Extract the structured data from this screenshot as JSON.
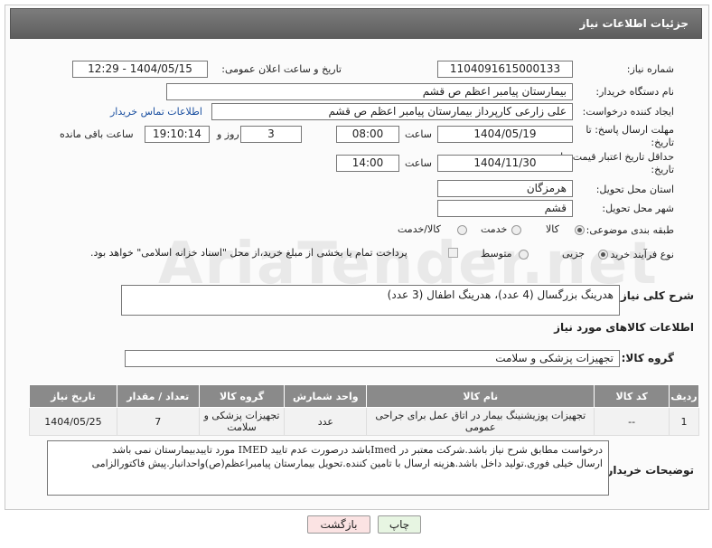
{
  "header": {
    "title": "جزئیات اطلاعات نیاز"
  },
  "fields": {
    "need_number_label": "شماره نیاز:",
    "need_number": "1104091615000133",
    "announce_label": "تاریخ و ساعت اعلان عمومی:",
    "announce_value": "1404/05/15 - 12:29",
    "buyer_org_label": "نام دستگاه خریدار:",
    "buyer_org": "بیمارستان پیامبر اعظم  ص  قشم",
    "requester_label": "ایجاد کننده درخواست:",
    "requester": "علی زارعی کارپرداز بیمارستان پیامبر اعظم  ص  قشم",
    "buyer_contact_link": "اطلاعات تماس خریدار",
    "reply_deadline_label": "مهلت ارسال پاسخ: تا تاریخ:",
    "reply_date": "1404/05/19",
    "time_label": "ساعت",
    "reply_time": "08:00",
    "days_value": "3",
    "days_label": "روز و",
    "remaining_time": "19:10:14",
    "remaining_label": "ساعت باقی مانده",
    "price_validity_label": "حداقل تاریخ اعتبار قیمت: تا تاریخ:",
    "price_date": "1404/11/30",
    "price_time": "14:00",
    "province_label": "استان محل تحویل:",
    "province": "هرمزگان",
    "city_label": "شهر محل تحویل:",
    "city": "قشم",
    "category_label": "طبقه بندی موضوعی:",
    "category_options": [
      "کالا",
      "خدمت",
      "کالا/خدمت"
    ],
    "purchase_type_label": "نوع فرآیند خرید :",
    "purchase_options": [
      "جزیی",
      "متوسط"
    ],
    "payment_note": "پرداخت تمام یا بخشی از مبلغ خرید،از محل \"اسناد خزانه اسلامی\" خواهد بود."
  },
  "summary": {
    "label": "شرح کلی نیاز:",
    "value": "هدرینگ بزرگسال (4 عدد)، هدرینگ اطفال (3 عدد)"
  },
  "goods": {
    "section_title": "اطلاعات کالاهای مورد نیاز",
    "group_label": "گروه کالا:",
    "group_value": "تجهیزات پزشکی و سلامت",
    "columns": [
      "ردیف",
      "کد کالا",
      "نام کالا",
      "واحد شمارش",
      "گروه کالا",
      "تعداد / مقدار",
      "تاریخ نیاز"
    ],
    "rows": [
      [
        "1",
        "--",
        "تجهیزات پوزیشنینگ بیمار در اتاق عمل برای جراحی عمومی",
        "عدد",
        "تجهیزات پزشکی و سلامت",
        "7",
        "1404/05/25"
      ]
    ]
  },
  "buyer_notes": {
    "label": "توضیحات خریدار:",
    "line1": "درخواست مطابق شرح نیاز باشد.شرکت معتبر در Imedباشد درصورت عدم تایید IMED مورد تاییدبیمارستان نمی باشد",
    "line2": "ارسال خیلی فوری.تولید داخل باشد.هزینه ارسال با تامین کننده.تحویل بیمارستان پیامبراعظم(ص)واحدانبار.پیش فاکتورالزامی"
  },
  "buttons": {
    "print": "چاپ",
    "back": "بازگشت"
  },
  "watermark": "AriaTender.net",
  "colors": {
    "title_bg": "#6b6b6b",
    "table_header": "#8a8a8a",
    "print_btn": "#e7f5e2",
    "back_btn": "#fbe3e3",
    "link": "#1a4fa0"
  }
}
